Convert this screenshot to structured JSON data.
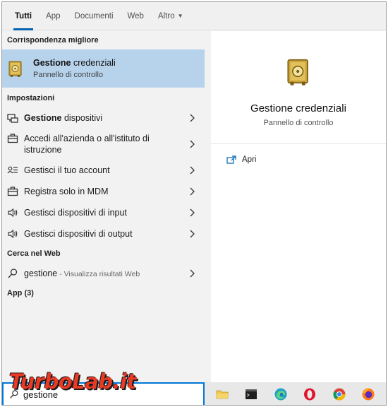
{
  "tabs": [
    {
      "label": "Tutti",
      "active": true
    },
    {
      "label": "App"
    },
    {
      "label": "Documenti"
    },
    {
      "label": "Web"
    },
    {
      "label": "Altro"
    }
  ],
  "best_match": {
    "section": "Corrispondenza migliore",
    "title_bold": "Gestione",
    "title_rest": " credenziali",
    "subtitle": "Pannello di controllo",
    "icon": "credential-manager-icon"
  },
  "settings": {
    "section": "Impostazioni",
    "items": [
      {
        "icon": "device-manager-icon",
        "bold": "Gestione",
        "rest": " dispositivi"
      },
      {
        "icon": "briefcase-icon",
        "bold": "",
        "rest": "Accedi all'azienda o all'istituto di istruzione"
      },
      {
        "icon": "account-icon",
        "bold": "",
        "rest": "Gestisci il tuo account"
      },
      {
        "icon": "briefcase-icon",
        "bold": "",
        "rest": "Registra solo in MDM"
      },
      {
        "icon": "speaker-icon",
        "bold": "",
        "rest": "Gestisci dispositivi di input"
      },
      {
        "icon": "speaker-icon",
        "bold": "",
        "rest": "Gestisci dispositivi di output"
      }
    ]
  },
  "web": {
    "section": "Cerca nel Web",
    "query": "gestione",
    "suffix": " - Visualizza risultati Web"
  },
  "apps": {
    "section": "App (3)"
  },
  "preview": {
    "title": "Gestione credenziali",
    "subtitle": "Pannello di controllo",
    "action": "Apri"
  },
  "search": {
    "value": "gestione"
  },
  "taskbar": [
    "file-explorer-icon",
    "terminal-icon",
    "edge-icon",
    "opera-icon",
    "chrome-icon",
    "firefox-icon"
  ],
  "watermark": "TurboLab.it",
  "colors": {
    "accent": "#0078d7",
    "selection": "#b7d3ec"
  }
}
